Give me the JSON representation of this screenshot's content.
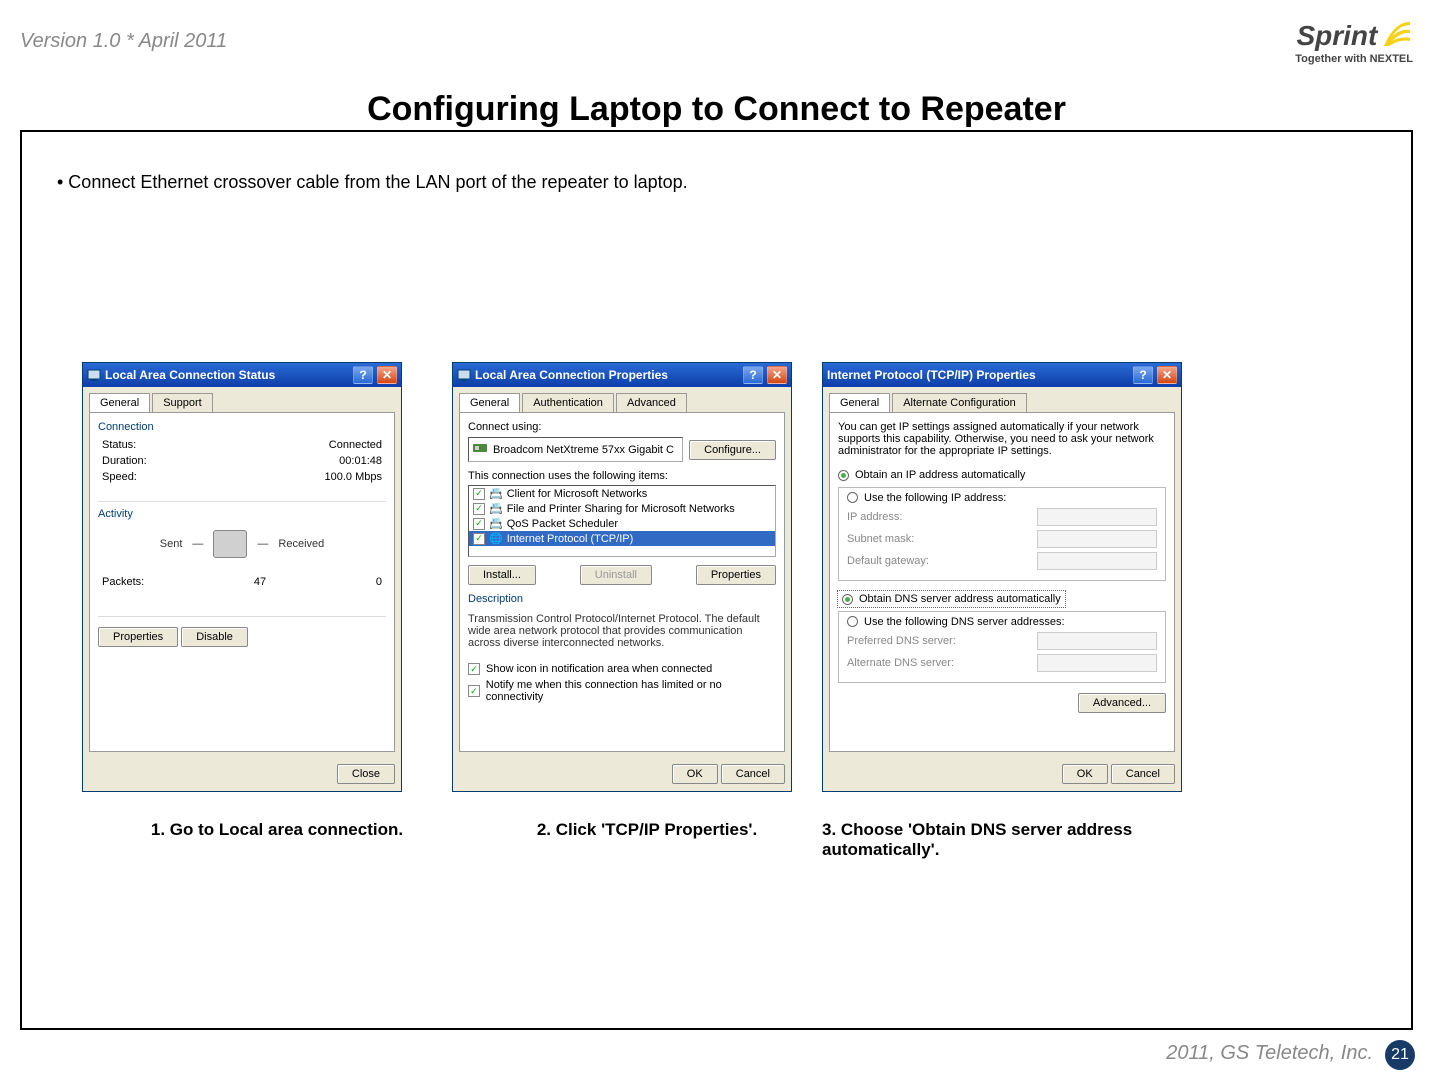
{
  "header": {
    "version": "Version 1.0 * April 2011",
    "brand": "Sprint",
    "tagline": "Together with NEXTEL"
  },
  "title": "Configuring Laptop to Connect to Repeater",
  "bullet": "• Connect Ethernet crossover cable from the LAN port of the repeater to laptop.",
  "dialog1": {
    "title": "Local Area Connection Status",
    "tabs": [
      "General",
      "Support"
    ],
    "section_connection": "Connection",
    "status_label": "Status:",
    "status_value": "Connected",
    "duration_label": "Duration:",
    "duration_value": "00:01:48",
    "speed_label": "Speed:",
    "speed_value": "100.0 Mbps",
    "section_activity": "Activity",
    "sent_label": "Sent",
    "received_label": "Received",
    "packets_label": "Packets:",
    "packets_sent": "47",
    "packets_received": "0",
    "btn_properties": "Properties",
    "btn_disable": "Disable",
    "btn_close": "Close"
  },
  "dialog2": {
    "title": "Local Area Connection Properties",
    "tabs": [
      "General",
      "Authentication",
      "Advanced"
    ],
    "connect_using_label": "Connect using:",
    "adapter": "Broadcom NetXtreme 57xx Gigabit C",
    "btn_configure": "Configure...",
    "items_label": "This connection uses the following items:",
    "items": [
      "Client for Microsoft Networks",
      "File and Printer Sharing for Microsoft Networks",
      "QoS Packet Scheduler",
      "Internet Protocol (TCP/IP)"
    ],
    "btn_install": "Install...",
    "btn_uninstall": "Uninstall",
    "btn_properties": "Properties",
    "desc_label": "Description",
    "desc_text": "Transmission Control Protocol/Internet Protocol. The default wide area network protocol that provides communication across diverse interconnected networks.",
    "chk_showicon": "Show icon in notification area when connected",
    "chk_notify": "Notify me when this connection has limited or no connectivity",
    "btn_ok": "OK",
    "btn_cancel": "Cancel"
  },
  "dialog3": {
    "title": "Internet Protocol (TCP/IP) Properties",
    "tabs": [
      "General",
      "Alternate Configuration"
    ],
    "intro": "You can get IP settings assigned automatically if your network supports this capability. Otherwise, you need to ask your network administrator for the appropriate IP settings.",
    "radio_obtain_ip": "Obtain an IP address automatically",
    "radio_use_ip": "Use the following IP address:",
    "ip_address_label": "IP address:",
    "subnet_label": "Subnet mask:",
    "gateway_label": "Default gateway:",
    "radio_obtain_dns": "Obtain DNS server address automatically",
    "radio_use_dns": "Use the following DNS server addresses:",
    "pref_dns_label": "Preferred DNS server:",
    "alt_dns_label": "Alternate DNS server:",
    "btn_advanced": "Advanced...",
    "btn_ok": "OK",
    "btn_cancel": "Cancel"
  },
  "steps": {
    "s1": "1. Go to Local area connection.",
    "s2": "2. Click 'TCP/IP Properties'.",
    "s3": "3. Choose 'Obtain DNS server address automatically'."
  },
  "footer": {
    "copyright": "2011, GS Teletech, Inc.",
    "page": "21"
  }
}
